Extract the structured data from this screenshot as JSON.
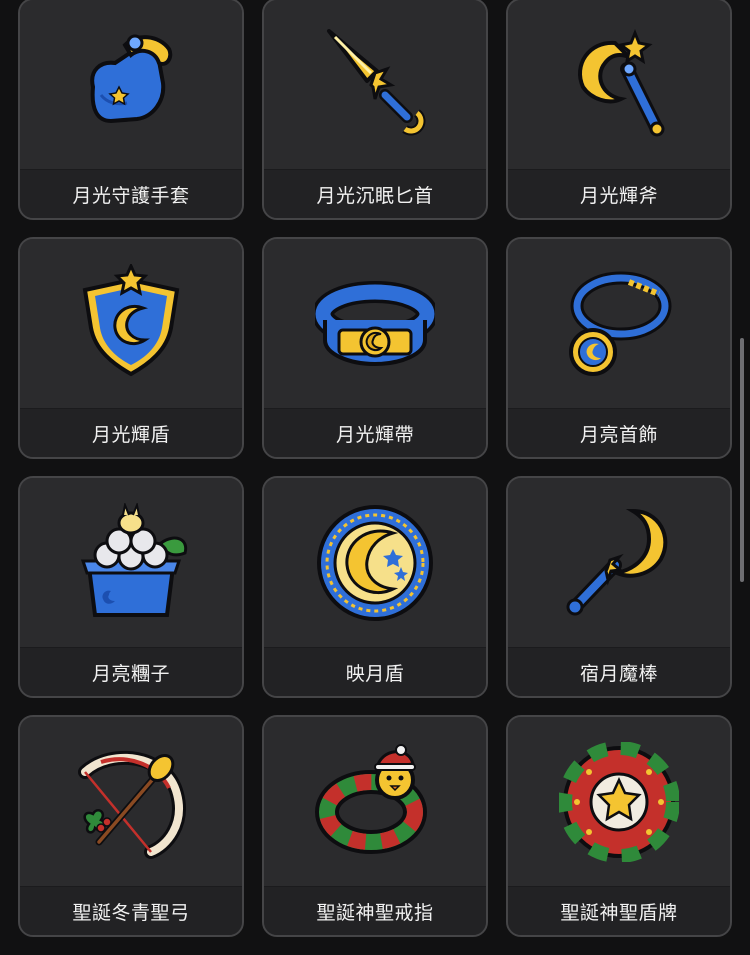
{
  "items": [
    {
      "name": "月光守護手套",
      "icon": "moon-glove-icon"
    },
    {
      "name": "月光沉眠匕首",
      "icon": "moon-dagger-icon"
    },
    {
      "name": "月光輝斧",
      "icon": "moon-axe-icon"
    },
    {
      "name": "月光輝盾",
      "icon": "moon-shield-icon"
    },
    {
      "name": "月光輝帶",
      "icon": "moon-belt-icon"
    },
    {
      "name": "月亮首飾",
      "icon": "moon-pendant-icon"
    },
    {
      "name": "月亮糰子",
      "icon": "moon-dango-icon"
    },
    {
      "name": "映月盾",
      "icon": "moon-round-shield-icon"
    },
    {
      "name": "宿月魔棒",
      "icon": "crescent-wand-icon"
    },
    {
      "name": "聖誕冬青聖弓",
      "icon": "holly-bow-icon"
    },
    {
      "name": "聖誕神聖戒指",
      "icon": "christmas-ring-icon"
    },
    {
      "name": "聖誕神聖盾牌",
      "icon": "christmas-shield-icon"
    }
  ],
  "colors": {
    "background": "#111112",
    "card": "#2a2a2c",
    "label_bar": "#222224",
    "gold": "#f4c431",
    "blue": "#2f6fd8",
    "red": "#c4302b",
    "green": "#2f8a3a"
  }
}
